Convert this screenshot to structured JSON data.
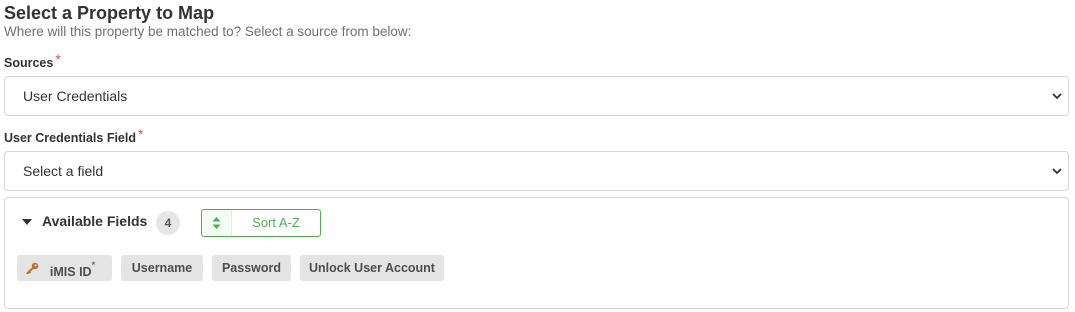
{
  "header": {
    "title": "Select a Property to Map",
    "subtitle": "Where will this property be matched to? Select a source from below:"
  },
  "sources": {
    "label": "Sources",
    "required_mark": "*",
    "selected": "User Credentials"
  },
  "field": {
    "label": "User Credentials Field",
    "required_mark": "*",
    "selected": "Select a field"
  },
  "available_fields": {
    "title": "Available Fields",
    "count": "4",
    "sort_label": "Sort A-Z",
    "items": [
      {
        "label": "iMIS ID",
        "marker": "*",
        "icon": "key-icon"
      },
      {
        "label": "Username"
      },
      {
        "label": "Password"
      },
      {
        "label": "Unlock User Account"
      }
    ]
  },
  "colors": {
    "required": "#d9534f",
    "sort_accent": "#4cae4c",
    "key_icon": "#b5733a",
    "chip_bg": "#e4e4e4"
  }
}
